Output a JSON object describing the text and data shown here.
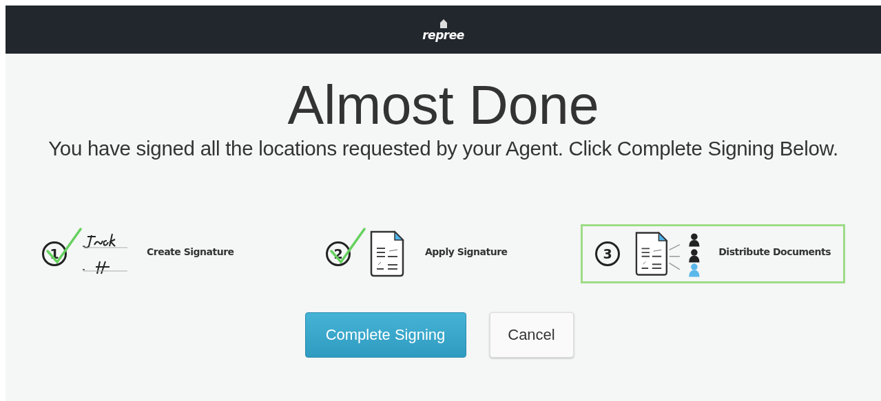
{
  "header": {
    "logo": "repree"
  },
  "title": "Almost Done",
  "message": "You have signed all the locations requested by your Agent. Click Complete Signing Below.",
  "steps": [
    {
      "number": "1",
      "label": "Create Signature",
      "kind": "signature",
      "done": true,
      "selected": false
    },
    {
      "number": "2",
      "label": "Apply Signature",
      "kind": "document",
      "done": true,
      "selected": false
    },
    {
      "number": "3",
      "label": "Distribute Documents",
      "kind": "distribute",
      "done": false,
      "selected": true
    }
  ],
  "buttons": [
    {
      "label": "Complete Signing",
      "kind": "primary"
    },
    {
      "label": "Cancel",
      "kind": "secondary"
    }
  ]
}
